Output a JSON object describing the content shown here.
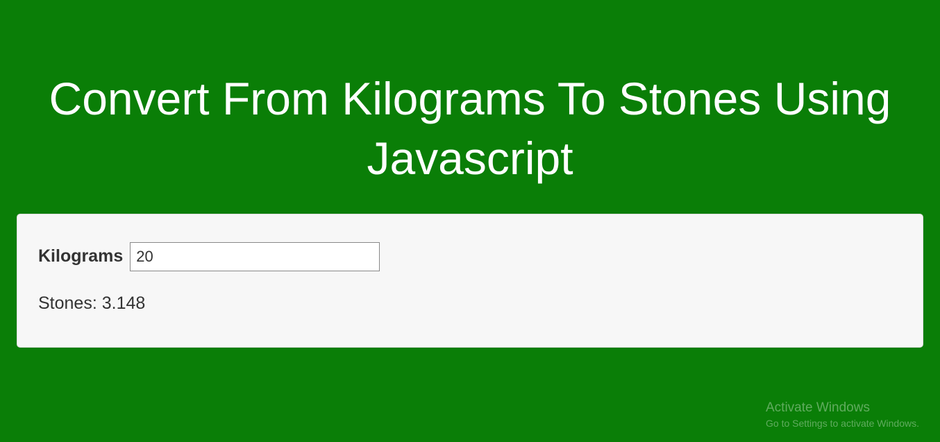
{
  "header": {
    "title": "Convert From Kilograms To Stones Using Javascript"
  },
  "form": {
    "kg_label": "Kilograms",
    "kg_value": "20",
    "result_label": "Stones:",
    "result_value": "3.148"
  },
  "watermark": {
    "line1": "Activate Windows",
    "line2": "Go to Settings to activate Windows."
  },
  "colors": {
    "background": "#0a7e07",
    "card_bg": "#f7f7f7",
    "text_dark": "#333333",
    "text_light": "#ffffff"
  }
}
